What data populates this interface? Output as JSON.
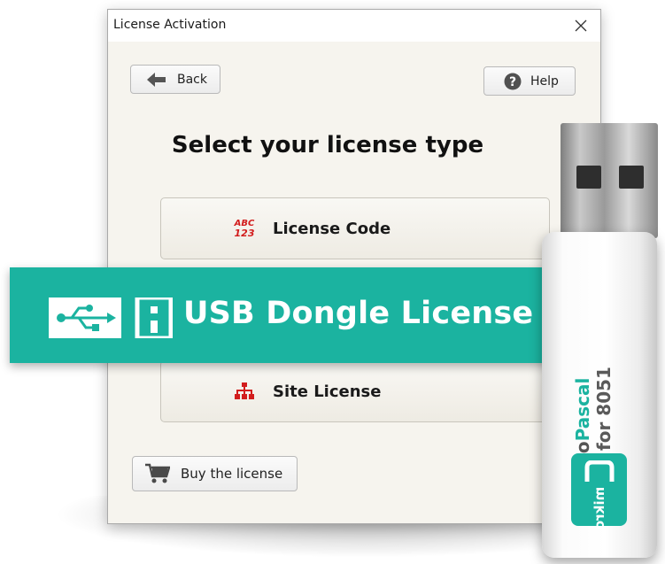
{
  "window": {
    "title": "License Activation",
    "close_symbol": "✕"
  },
  "toolbar": {
    "back_label": "Back",
    "help_label": "Help"
  },
  "heading": "Select your license type",
  "options": [
    {
      "label": "License Code",
      "icon": "abc-123-icon",
      "icon_text_top": "ABC",
      "icon_text_bottom": "123"
    },
    {
      "label": "USB Dongle License",
      "icon": "usb-dongle-icon"
    },
    {
      "label": "Site License",
      "icon": "network-icon"
    }
  ],
  "buy": {
    "label": "Buy the license",
    "icon": "cart-icon"
  },
  "usb_stick": {
    "brand_prefix": "mikro",
    "brand_name": "Pascal",
    "edition": "PRO for 8051",
    "logo_text": "mikro"
  },
  "colors": {
    "accent_teal": "#1bb3a0",
    "icon_red": "#d21d1d",
    "dialog_bg": "#f6f4ee"
  }
}
